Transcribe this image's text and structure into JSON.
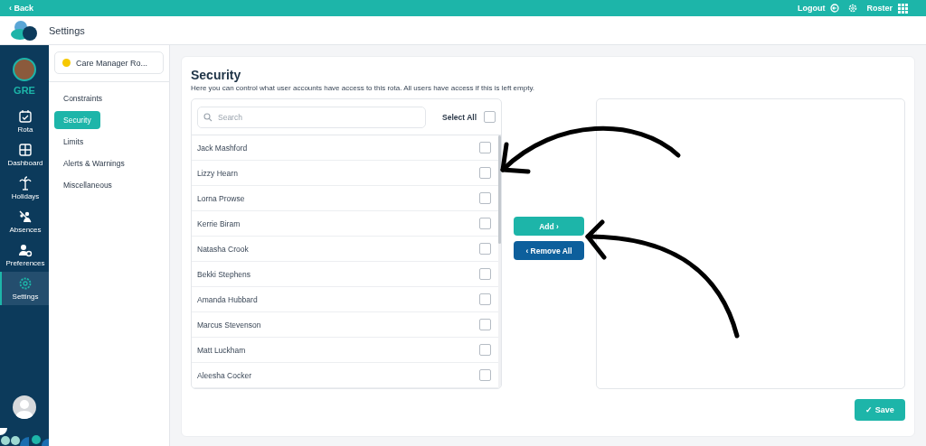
{
  "top_bar": {
    "back": "‹ Back",
    "logout": "Logout",
    "roster": "Roster"
  },
  "header": {
    "title": "Settings"
  },
  "nav": {
    "site": "GRE",
    "items": [
      {
        "label": "Rota",
        "selected": false
      },
      {
        "label": "Dashboard",
        "selected": false
      },
      {
        "label": "Holidays",
        "selected": false
      },
      {
        "label": "Absences",
        "selected": false
      },
      {
        "label": "Preferences",
        "selected": false
      },
      {
        "label": "Settings",
        "selected": true
      }
    ]
  },
  "submenu": {
    "dropdown": "Care Manager Ro...",
    "items": [
      {
        "label": "Constraints",
        "selected": false
      },
      {
        "label": "Security",
        "selected": true
      },
      {
        "label": "Limits",
        "selected": false
      },
      {
        "label": "Alerts & Warnings",
        "selected": false
      },
      {
        "label": "Miscellaneous",
        "selected": false
      }
    ]
  },
  "security": {
    "title": "Security",
    "description": "Here you can control what user accounts have access to this rota. All users have access if this is left empty.",
    "search": {
      "placeholder": "Search"
    },
    "select_all": {
      "label": "Select All",
      "checked": false
    },
    "users": [
      {
        "name": "Jack Mashford",
        "checked": false
      },
      {
        "name": "Lizzy Hearn",
        "checked": false
      },
      {
        "name": "Lorna Prowse",
        "checked": false
      },
      {
        "name": "Kerrie Biram",
        "checked": false
      },
      {
        "name": "Natasha Crook",
        "checked": false
      },
      {
        "name": "Bekki Stephens",
        "checked": false
      },
      {
        "name": "Amanda Hubbard",
        "checked": false
      },
      {
        "name": "Marcus Stevenson",
        "checked": false
      },
      {
        "name": "Matt Luckham",
        "checked": false
      },
      {
        "name": "Aleesha Cocker",
        "checked": false
      }
    ],
    "add_button": "Add ›",
    "remove_button": "‹ Remove All",
    "save_button": "✓ Save"
  }
}
